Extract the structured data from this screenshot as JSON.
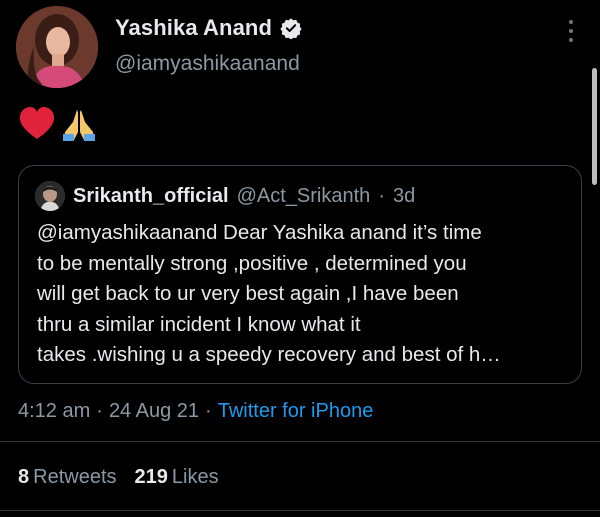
{
  "author": {
    "display_name": "Yashika Anand",
    "handle": "@iamyashikaanand",
    "verified": true
  },
  "tweet": {
    "emojis": [
      "red-heart",
      "folded-hands"
    ]
  },
  "quoted_tweet": {
    "display_name": "Srikanth_official",
    "handle": "@Act_Srikanth",
    "separator": "·",
    "age": "3d",
    "lines": [
      "@iamyashikaanand Dear Yashika anand it’s time",
      "to be mentally strong ,positive , determined you",
      "will get back to ur very best again ,I have been",
      "thru a similar incident I know what it",
      "takes .wishing u a speedy recovery and best of h…"
    ]
  },
  "meta": {
    "time": "4:12 am",
    "sep1": "·",
    "date": "24 Aug 21",
    "sep2": "·",
    "source": "Twitter for iPhone"
  },
  "stats": {
    "retweets_count": "8",
    "retweets_label": "Retweets",
    "likes_count": "219",
    "likes_label": "Likes"
  },
  "colors": {
    "background": "#000000",
    "text": "#e7e9ea",
    "muted": "#8b98a5",
    "link": "#1d9bf0",
    "verified": "#e7e9ea",
    "heart": "#e0233a"
  }
}
